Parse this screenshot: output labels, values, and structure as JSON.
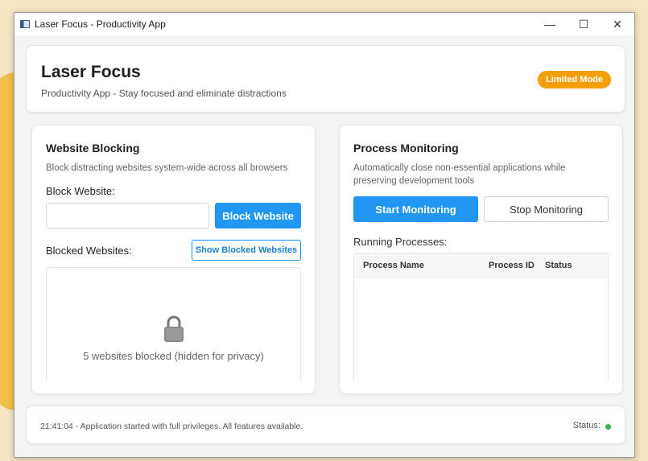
{
  "window": {
    "title": "Laser Focus - Productivity App",
    "controls": {
      "minimize": "—",
      "maximize": "☐",
      "close": "✕"
    }
  },
  "header": {
    "title": "Laser Focus",
    "subtitle": "Productivity App - Stay focused and eliminate distractions",
    "badge": "Limited Mode",
    "badge_color": "#f59e0b"
  },
  "website_blocking": {
    "title": "Website Blocking",
    "description": "Block distracting websites system-wide across all browsers",
    "input_label": "Block Website:",
    "input_value": "",
    "input_placeholder": "",
    "block_button": "Block Website",
    "blocked_label": "Blocked Websites:",
    "show_button": "Show Blocked Websites",
    "blocked_summary": "5 websites blocked (hidden for privacy)",
    "icon": "lock-icon"
  },
  "process_monitoring": {
    "title": "Process Monitoring",
    "description": "Automatically close non-essential applications while preserving development tools",
    "start_button": "Start Monitoring",
    "stop_button": "Stop Monitoring",
    "running_label": "Running Processes:",
    "columns": [
      "Process Name",
      "Process ID",
      "Status"
    ],
    "rows": []
  },
  "status_bar": {
    "log": "21:41:04 - Application started with full privileges. All features available.",
    "status_label": "Status:",
    "status_color": "#2db84d"
  },
  "colors": {
    "accent": "#2196f3",
    "badge": "#f59e0b",
    "status_ok": "#2db84d"
  }
}
